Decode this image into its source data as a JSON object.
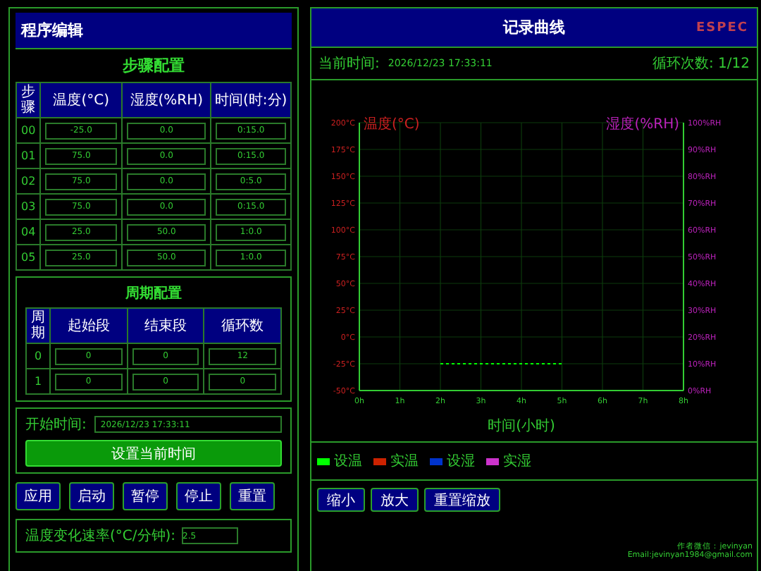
{
  "program_panel": {
    "title": "程序编辑",
    "steps": {
      "title": "步骤配置",
      "columns": [
        "步骤",
        "温度(°C)",
        "湿度(%RH)",
        "时间(时:分)"
      ],
      "rows": [
        {
          "step": "00",
          "temp": "-25.0",
          "humidity": "0.0",
          "time": "0:15.0"
        },
        {
          "step": "01",
          "temp": "75.0",
          "humidity": "0.0",
          "time": "0:15.0"
        },
        {
          "step": "02",
          "temp": "75.0",
          "humidity": "0.0",
          "time": "0:5.0"
        },
        {
          "step": "03",
          "temp": "75.0",
          "humidity": "0.0",
          "time": "0:15.0"
        },
        {
          "step": "04",
          "temp": "25.0",
          "humidity": "50.0",
          "time": "1:0.0"
        },
        {
          "step": "05",
          "temp": "25.0",
          "humidity": "50.0",
          "time": "1:0.0"
        }
      ]
    },
    "cycles": {
      "title": "周期配置",
      "columns": [
        "周期",
        "起始段",
        "结束段",
        "循环数"
      ],
      "rows": [
        {
          "cycle": "0",
          "start": "0",
          "end": "0",
          "count": "12"
        },
        {
          "cycle": "1",
          "start": "0",
          "end": "0",
          "count": "0"
        }
      ]
    },
    "start_time": {
      "label": "开始时间:",
      "value": "2026/12/23 17:33:11",
      "button": "设置当前时间"
    },
    "buttons": [
      "应用",
      "启动",
      "暂停",
      "停止",
      "重置"
    ],
    "rate": {
      "label": "温度变化速率(°C/分钟):",
      "value": "2.5"
    }
  },
  "record_panel": {
    "title": "记录曲线",
    "logo": "ESPEC",
    "current_time_label": "当前时间:",
    "current_time": "2026/12/23 17:33:11",
    "cycle_count": "循环次数: 1/12",
    "chart": {
      "chart_data": {
        "type": "line",
        "xlabel": "时间(小时)",
        "ylabel": "温度(°C)",
        "y2label": "湿度(%RH)",
        "x": [
          2,
          5
        ],
        "grid": true,
        "series": [
          {
            "name": "设温",
            "color": "#00ff00",
            "line_style": "dashed",
            "values": [
              -25,
              -25
            ]
          },
          {
            "name": "实温",
            "color": "#cc2200",
            "values": [
              null,
              null
            ]
          },
          {
            "name": "设湿",
            "color": "#0033cc",
            "values": [
              null,
              null
            ]
          },
          {
            "name": "实湿",
            "color": "#cc33cc",
            "values": [
              null,
              null
            ]
          }
        ],
        "xlim": [
          0,
          8
        ],
        "ylim": [
          -50,
          200
        ],
        "xticks": [
          {
            "value": 0,
            "label": "0h"
          },
          {
            "value": 1,
            "label": "1h"
          },
          {
            "value": 2,
            "label": "2h"
          },
          {
            "value": 3,
            "label": "3h"
          },
          {
            "value": 4,
            "label": "4h"
          },
          {
            "value": 5,
            "label": "5h"
          },
          {
            "value": 6,
            "label": "6h"
          },
          {
            "value": 7,
            "label": "7h"
          },
          {
            "value": 8,
            "label": "8h"
          }
        ],
        "yticks": [
          {
            "value": 200,
            "label": "200°C"
          },
          {
            "value": 175,
            "label": "175°C"
          },
          {
            "value": 150,
            "label": "150°C"
          },
          {
            "value": 125,
            "label": "125°C"
          },
          {
            "value": 100,
            "label": "100°C"
          },
          {
            "value": 75,
            "label": "75°C"
          },
          {
            "value": 50,
            "label": "50°C"
          },
          {
            "value": 25,
            "label": "25°C"
          },
          {
            "value": 0,
            "label": "0°C"
          },
          {
            "value": -25,
            "label": "-25°C"
          },
          {
            "value": -50,
            "label": "-50°C"
          }
        ],
        "y2ticks": [
          "100%RH",
          "90%RH",
          "80%RH",
          "70%RH",
          "60%RH",
          "50%RH",
          "40%RH",
          "30%RH",
          "20%RH",
          "10%RH",
          "0%RH"
        ]
      }
    },
    "zoom_buttons": [
      "缩小",
      "放大",
      "重置缩放"
    ],
    "author": "作者微信：jevinyan",
    "email": "Email:jevinyan1984@gmail.com"
  }
}
